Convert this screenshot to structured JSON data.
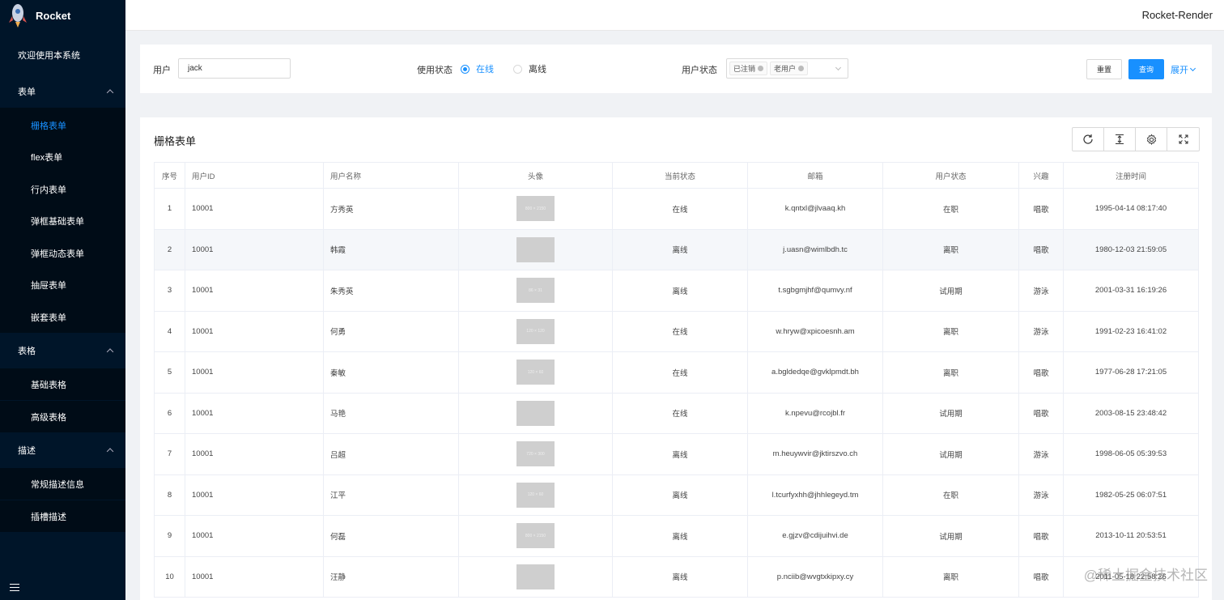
{
  "app": {
    "title": "Rocket",
    "header_title": "Rocket-Render"
  },
  "sidebar": {
    "welcome": "欢迎使用本系统",
    "groups": [
      {
        "label": "表单",
        "items": [
          "栅格表单",
          "flex表单",
          "行内表单",
          "弹框基础表单",
          "弹框动态表单",
          "抽屉表单",
          "嵌套表单"
        ]
      },
      {
        "label": "表格",
        "items": [
          "基础表格",
          "高级表格"
        ]
      },
      {
        "label": "描述",
        "items": [
          "常规描述信息",
          "插槽描述"
        ]
      }
    ],
    "active": "栅格表单"
  },
  "search": {
    "user_label": "用户",
    "user_value": "jack",
    "usage_label": "使用状态",
    "usage_options": [
      "在线",
      "离线"
    ],
    "usage_selected": "在线",
    "status_label": "用户状态",
    "status_tags": [
      "已注销",
      "老用户"
    ],
    "reset_label": "重置",
    "query_label": "查询",
    "expand_label": "展开"
  },
  "table": {
    "title": "栅格表单",
    "columns": [
      "序号",
      "用户ID",
      "用户名称",
      "头像",
      "当前状态",
      "邮箱",
      "用户状态",
      "兴趣",
      "注册时间"
    ],
    "rows": [
      {
        "idx": "1",
        "id": "10001",
        "name": "方秀英",
        "avatar": "800 × 2150",
        "state": "在线",
        "email": "k.qntxl@jlvaaq.kh",
        "status": "在职",
        "hobby": "唱歌",
        "time": "1995-04-14 08:17:40"
      },
      {
        "idx": "2",
        "id": "10001",
        "name": "韩霞",
        "avatar": "",
        "state": "离线",
        "email": "j.uasn@wimlbdh.tc",
        "status": "离职",
        "hobby": "唱歌",
        "time": "1980-12-03 21:59:05"
      },
      {
        "idx": "3",
        "id": "10001",
        "name": "朱秀英",
        "avatar": "86 × 31",
        "state": "离线",
        "email": "t.sgbgmjhf@qumvy.nf",
        "status": "试用期",
        "hobby": "游泳",
        "time": "2001-03-31 16:19:26"
      },
      {
        "idx": "4",
        "id": "10001",
        "name": "何勇",
        "avatar": "120 × 120",
        "state": "在线",
        "email": "w.hryw@xpicoesnh.am",
        "status": "离职",
        "hobby": "游泳",
        "time": "1991-02-23 16:41:02"
      },
      {
        "idx": "5",
        "id": "10001",
        "name": "秦敏",
        "avatar": "120 × 60",
        "state": "在线",
        "email": "a.bgldedqe@gvklpmdt.bh",
        "status": "离职",
        "hobby": "唱歌",
        "time": "1977-06-28 17:21:05"
      },
      {
        "idx": "6",
        "id": "10001",
        "name": "马艳",
        "avatar": "",
        "state": "在线",
        "email": "k.npevu@rcojbl.fr",
        "status": "试用期",
        "hobby": "唱歌",
        "time": "2003-08-15 23:48:42"
      },
      {
        "idx": "7",
        "id": "10001",
        "name": "吕超",
        "avatar": "720 × 300",
        "state": "离线",
        "email": "m.heuywvir@jktirszvo.ch",
        "status": "试用期",
        "hobby": "游泳",
        "time": "1998-06-05 05:39:53"
      },
      {
        "idx": "8",
        "id": "10001",
        "name": "江平",
        "avatar": "120 × 60",
        "state": "离线",
        "email": "l.tcurfyxhh@jhhlegeyd.tm",
        "status": "在职",
        "hobby": "游泳",
        "time": "1982-05-25 06:07:51"
      },
      {
        "idx": "9",
        "id": "10001",
        "name": "何磊",
        "avatar": "800 × 2150",
        "state": "离线",
        "email": "e.gjzv@cdijuihvi.de",
        "status": "试用期",
        "hobby": "唱歌",
        "time": "2013-10-11 20:53:51"
      },
      {
        "idx": "10",
        "id": "10001",
        "name": "汪静",
        "avatar": "",
        "state": "离线",
        "email": "p.nciib@wvgtxkipxy.cy",
        "status": "离职",
        "hobby": "唱歌",
        "time": "2011-05-18 22:58:26"
      }
    ]
  },
  "watermark": "@稀土掘金技术社区",
  "colors": {
    "sidebar": "#001529",
    "primary": "#1890ff"
  }
}
